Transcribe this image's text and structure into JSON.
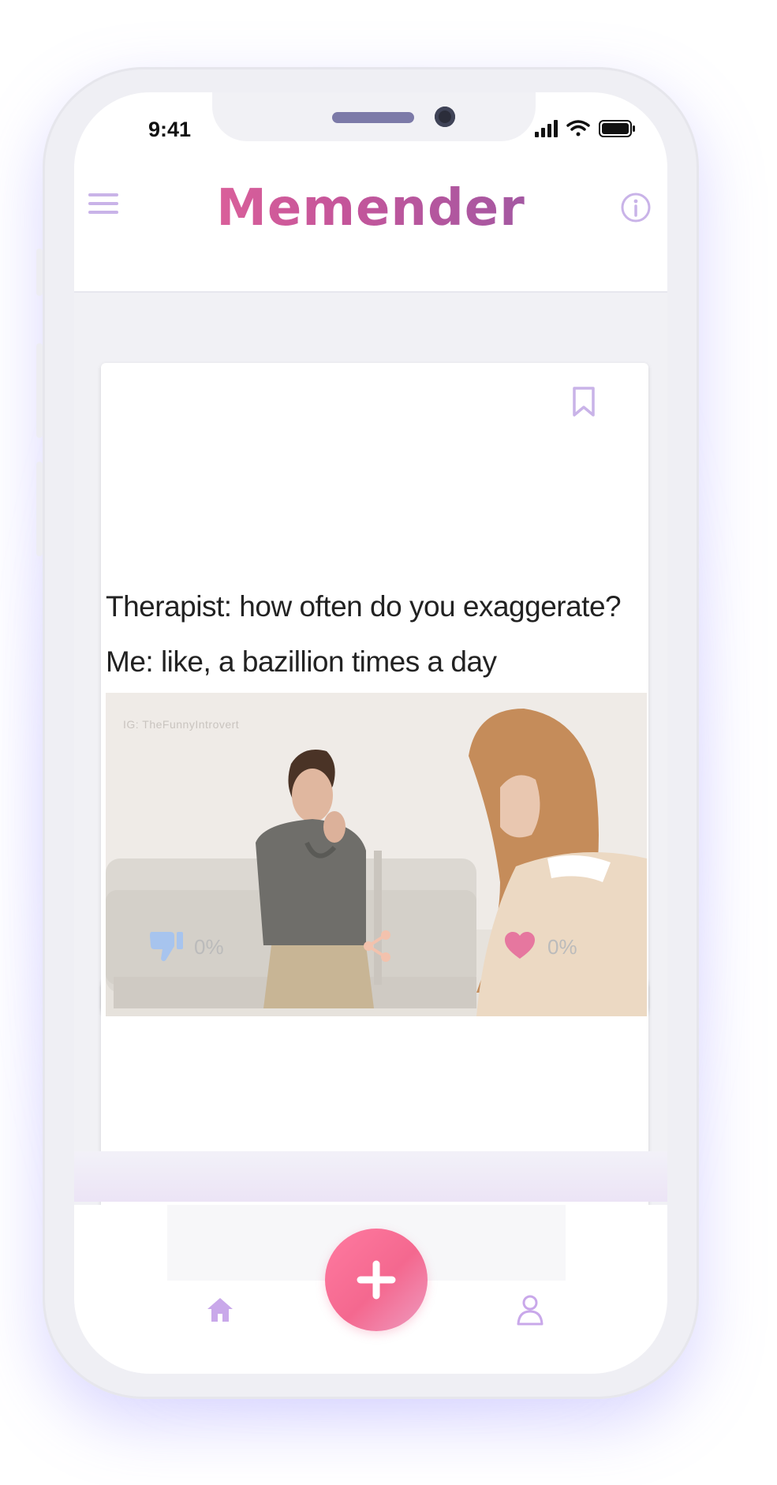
{
  "status_bar": {
    "time": "9:41"
  },
  "header": {
    "app_title": "Memender"
  },
  "meme": {
    "caption_line1": "Therapist: how often do you exaggerate?",
    "caption_line2": "Me: like, a bazillion times a day",
    "watermark": "IG: TheFunnyIntrovert"
  },
  "actions": {
    "dislike_percent": "0%",
    "like_percent": "0%"
  },
  "colors": {
    "brand_pink": "#f06b9a",
    "brand_purple": "#8a5aa8",
    "icon_lavender": "#c9b3e8",
    "dislike_blue": "#a7c4ee",
    "share_peach": "#f3c2ad",
    "like_pink": "#e6779f"
  },
  "icons": {
    "menu": "hamburger-menu-icon",
    "info": "info-circle-icon",
    "bookmark": "bookmark-icon",
    "dislike": "thumbs-down-icon",
    "share": "share-icon",
    "like": "heart-icon",
    "add": "plus-icon",
    "home": "home-icon",
    "profile": "user-icon"
  }
}
